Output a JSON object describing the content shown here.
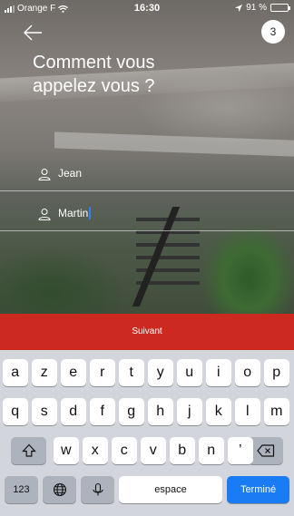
{
  "status_bar": {
    "carrier": "Orange F",
    "time": "16:30",
    "battery": "91 %",
    "battery_level": 0.91
  },
  "header": {
    "step": "3",
    "title": "Comment vous\nappelez vous ?"
  },
  "form": {
    "first_name": "Jean",
    "last_name": "Martin"
  },
  "next_button": "Suivant",
  "keyboard": {
    "row1": [
      "a",
      "z",
      "e",
      "r",
      "t",
      "y",
      "u",
      "i",
      "o",
      "p"
    ],
    "row2": [
      "q",
      "s",
      "d",
      "f",
      "g",
      "h",
      "j",
      "k",
      "l",
      "m"
    ],
    "row3": [
      "w",
      "x",
      "c",
      "v",
      "b",
      "n",
      "’"
    ],
    "numbers_key": "123",
    "space_key": "espace",
    "done_key": "Terminé"
  },
  "colors": {
    "accent_red": "#cc2a21",
    "done_blue": "#1a7cf5",
    "keyboard_bg": "#d2d5db"
  }
}
